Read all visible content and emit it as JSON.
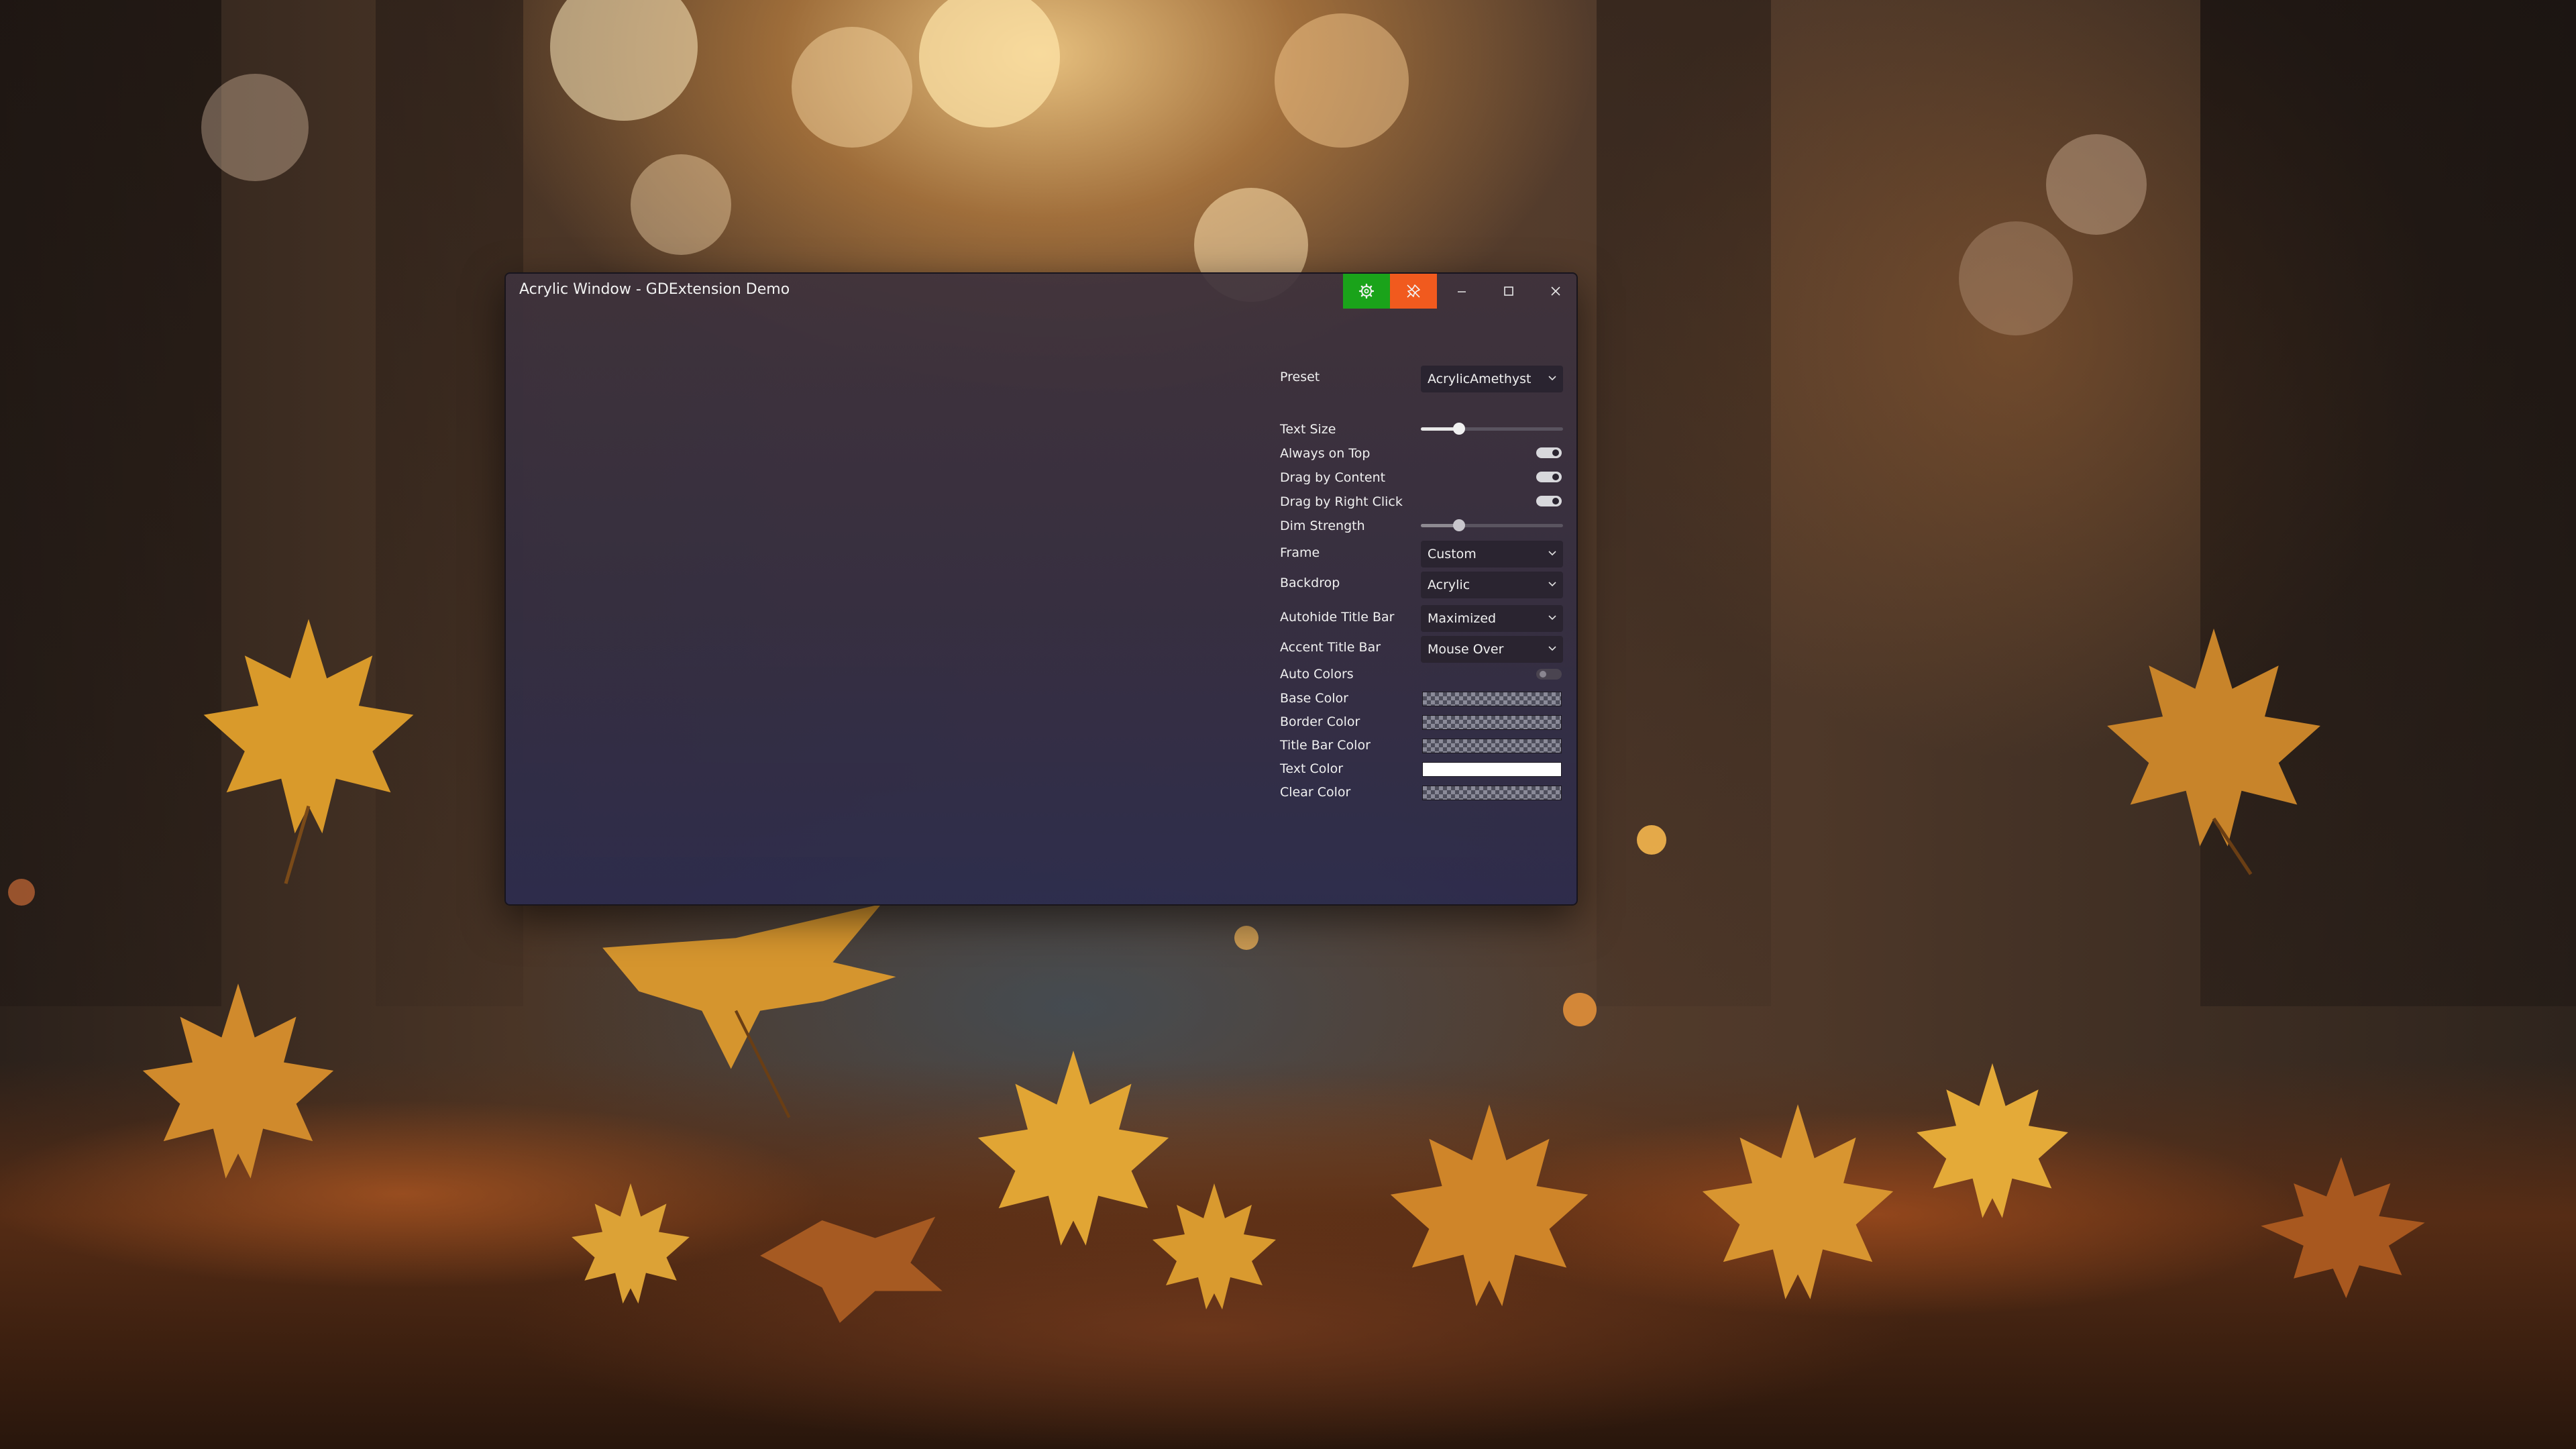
{
  "window": {
    "title": "Acrylic Window - GDExtension Demo",
    "buttons": {
      "settings_color": "#1aa31a",
      "pin_color": "#f15a1e",
      "settings_icon": "gear-icon",
      "pin_icon": "pin-off-icon",
      "minimize_icon": "minimize-icon",
      "maximize_icon": "maximize-icon",
      "close_icon": "close-icon"
    }
  },
  "settings": {
    "preset": {
      "label": "Preset",
      "value": "AcrylicAmethyst"
    },
    "text_size": {
      "label": "Text Size",
      "level": 0.27
    },
    "always_on_top": {
      "label": "Always on Top",
      "on": true
    },
    "drag_by_content": {
      "label": "Drag by Content",
      "on": true
    },
    "drag_by_right_click": {
      "label": "Drag by Right Click",
      "on": true
    },
    "dim_strength": {
      "label": "Dim Strength",
      "level": 0.27
    },
    "frame": {
      "label": "Frame",
      "value": "Custom"
    },
    "backdrop": {
      "label": "Backdrop",
      "value": "Acrylic"
    },
    "autohide_title_bar": {
      "label": "Autohide Title Bar",
      "value": "Maximized"
    },
    "accent_title_bar": {
      "label": "Accent Title Bar",
      "value": "Mouse Over"
    },
    "auto_colors": {
      "label": "Auto Colors",
      "on": false
    },
    "base_color": {
      "label": "Base Color"
    },
    "border_color": {
      "label": "Border Color"
    },
    "title_bar_color": {
      "label": "Title Bar Color"
    },
    "text_color": {
      "label": "Text Color",
      "color": "#ffffff"
    },
    "clear_color": {
      "label": "Clear Color"
    }
  }
}
